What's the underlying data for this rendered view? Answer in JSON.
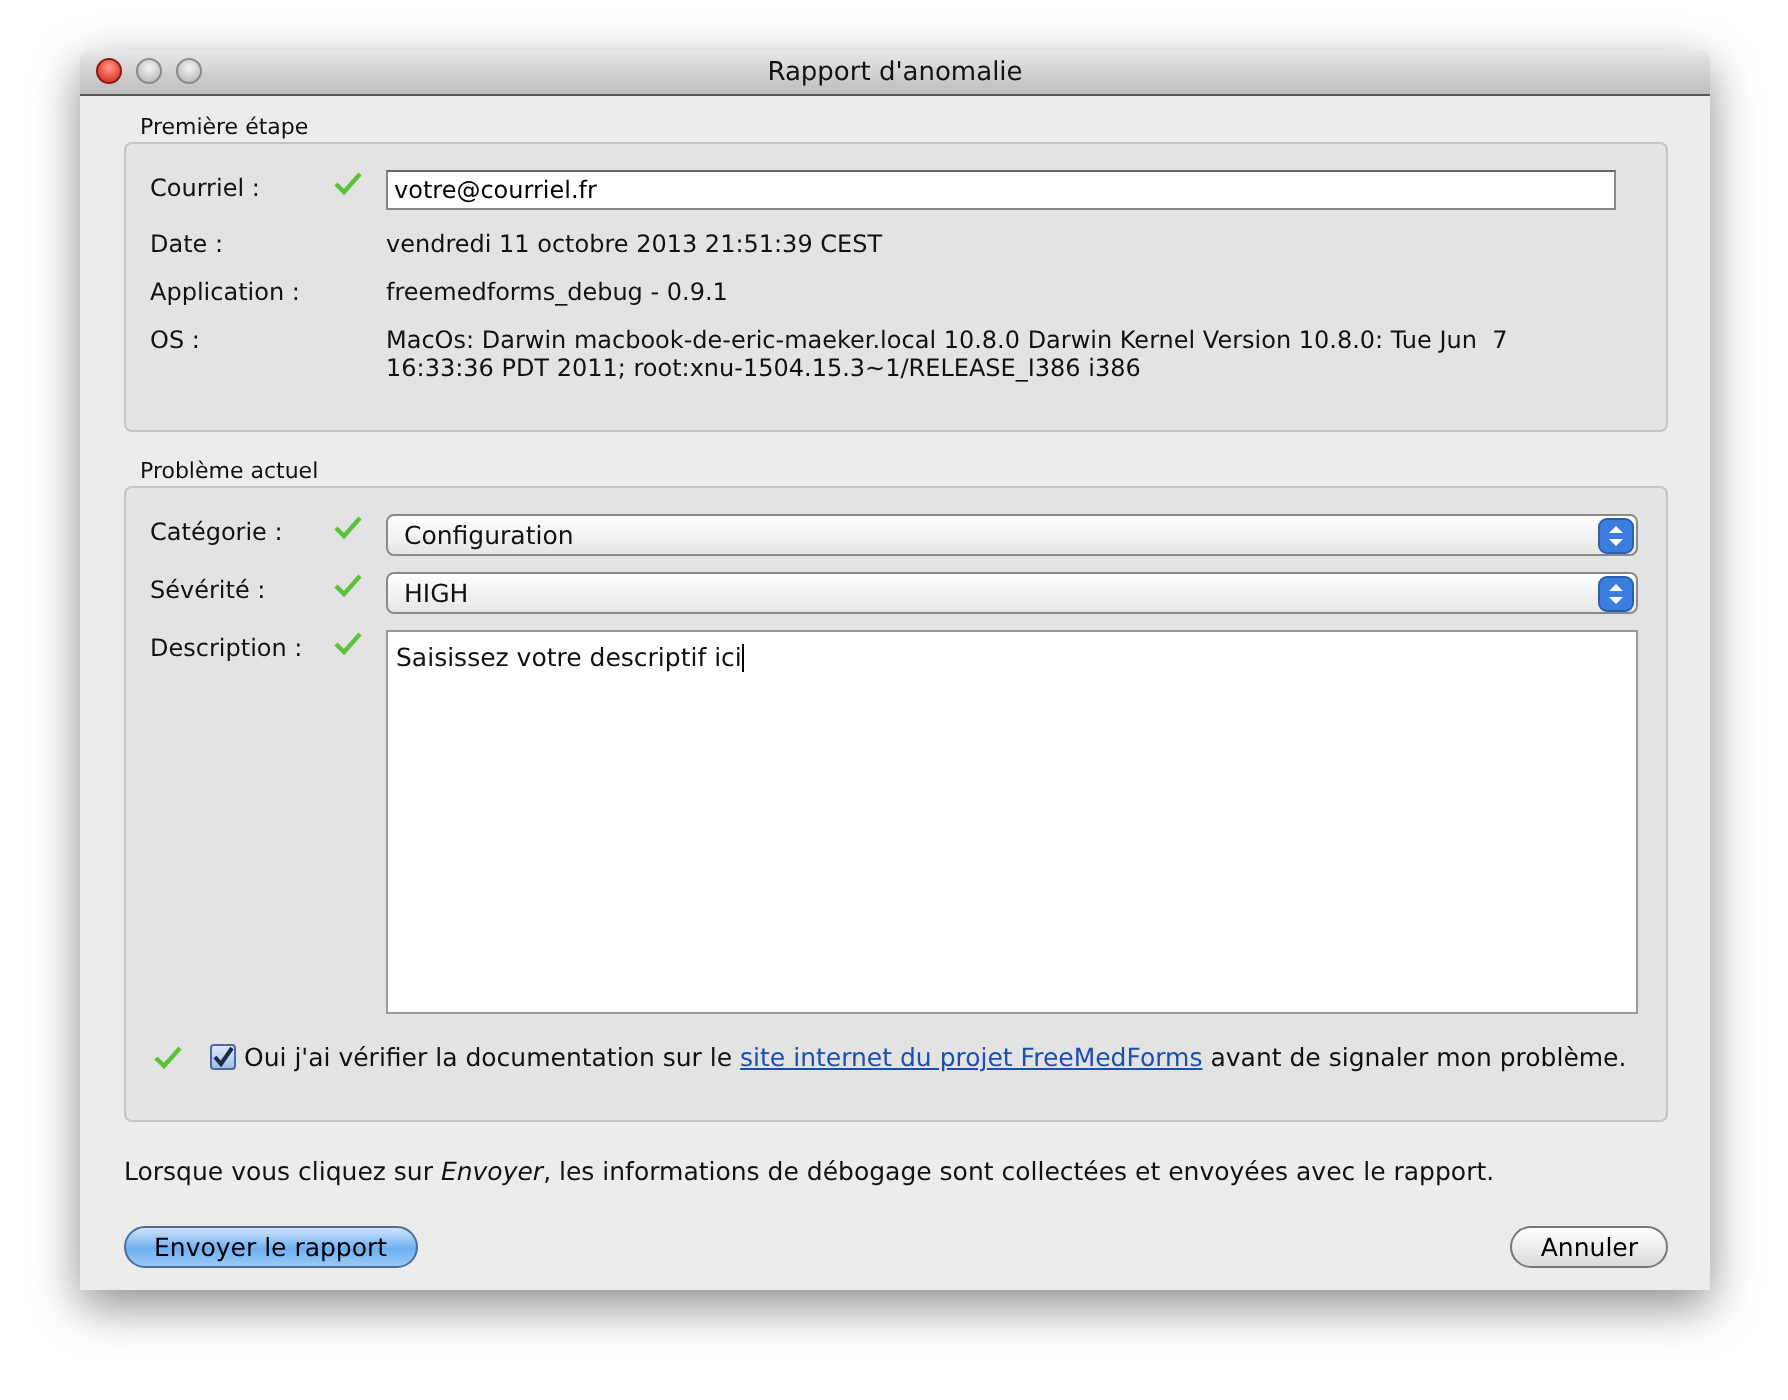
{
  "window": {
    "title": "Rapport d'anomalie"
  },
  "first_step": {
    "title": "Première étape",
    "rows": [
      {
        "kind": "input",
        "label": "Courriel :",
        "valid": true,
        "value": "votre@courriel.fr"
      },
      {
        "kind": "text",
        "label": "Date :",
        "valid": false,
        "lines": [
          "vendredi 11 octobre 2013 21:51:39 CEST"
        ]
      },
      {
        "kind": "text",
        "label": "Application :",
        "valid": false,
        "lines": [
          "freemedforms_debug - 0.9.1"
        ]
      },
      {
        "kind": "text",
        "label": "OS :",
        "valid": false,
        "lines": [
          "MacOs: Darwin macbook-de-eric-maeker.local 10.8.0 Darwin Kernel Version 10.8.0: Tue Jun  7",
          "16:33:36 PDT 2011; root:xnu-1504.15.3~1/RELEASE_I386 i386"
        ]
      }
    ]
  },
  "current_problem": {
    "title": "Problème actuel",
    "rows": [
      {
        "kind": "select",
        "label": "Catégorie :",
        "valid": true,
        "value": "Configuration"
      },
      {
        "kind": "select",
        "label": "Sévérité :",
        "valid": true,
        "value": "HIGH"
      },
      {
        "kind": "textarea",
        "label": "Description :",
        "valid": true,
        "value": "Saisissez votre descriptif ici"
      }
    ],
    "confirmation": {
      "valid": true,
      "checked": true,
      "before": "Oui j'ai vérifier la documentation sur le ",
      "link": "site internet du projet FreeMedForms",
      "after": " avant de signaler mon problème."
    }
  },
  "note": "Lorsque vous cliquez sur *Envoyer*, les informations de débogage sont collectées et envoyées avec le rapport.",
  "buttons": [
    {
      "label": "Envoyer le rapport",
      "default": true
    },
    {
      "label": "Annuler",
      "default": false
    }
  ]
}
